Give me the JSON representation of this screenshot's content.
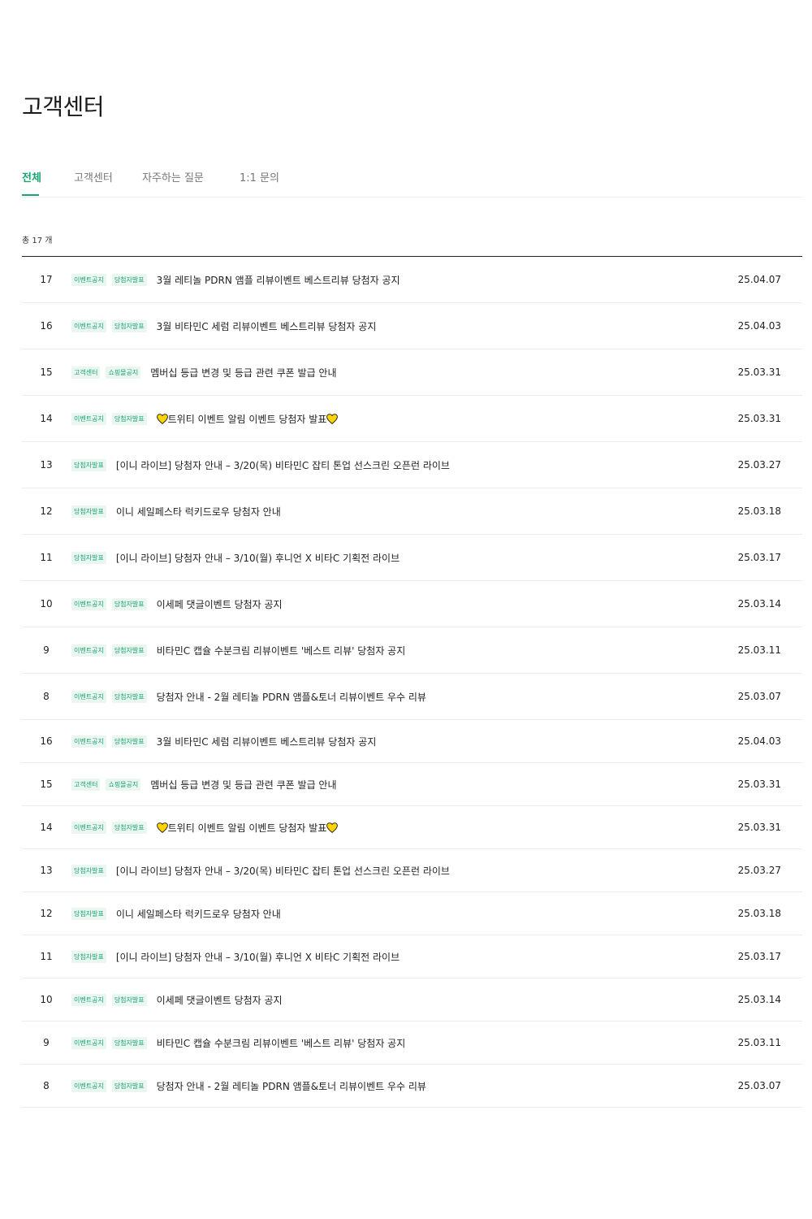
{
  "page_title": "고객센터",
  "tabs": [
    {
      "label": "전체",
      "active": true
    },
    {
      "label": "고객센터",
      "active": false
    },
    {
      "label": "자주하는 질문",
      "active": false
    },
    {
      "label": "1:1 문의",
      "active": false
    }
  ],
  "total_count": "총 17 개",
  "colors": {
    "accent": "#1aa46f",
    "badge_bg": "#eaf7f1",
    "heart": "#ffd400"
  },
  "icons": {
    "heart": "yellow-heart-icon"
  },
  "rows": [
    {
      "num": "17",
      "badges": [
        "이벤트공지",
        "당첨자발표"
      ],
      "pre": "",
      "title": "3월 레티놀 PDRN 앰플 리뷰이벤트 베스트리뷰 당첨자 공지",
      "post": "",
      "date": "25.04.07"
    },
    {
      "num": "16",
      "badges": [
        "이벤트공지",
        "당첨자발표"
      ],
      "pre": "",
      "title": "3월 비타민C 세럼 리뷰이벤트 베스트리뷰 당첨자 공지",
      "post": "",
      "date": "25.04.03"
    },
    {
      "num": "15",
      "badges": [
        "고객센터",
        "쇼핑몰공지"
      ],
      "pre": "",
      "title": "멤버십 등급 변경 및 등급 관련 쿠폰 발급 안내",
      "post": "",
      "date": "25.03.31"
    },
    {
      "num": "14",
      "badges": [
        "이벤트공지",
        "당첨자발표"
      ],
      "pre": "yellow-heart-icon",
      "title": "트위티 이벤트 알림 이벤트 당첨자 발표",
      "post": "yellow-heart-icon",
      "date": "25.03.31"
    },
    {
      "num": "13",
      "badges": [
        "당첨자발표"
      ],
      "pre": "",
      "title": "[이니 라이브] 당첨자 안내 – 3/20(목) 비타민C 잡티 톤업 선스크린 오픈런 라이브",
      "post": "",
      "date": "25.03.27"
    },
    {
      "num": "12",
      "badges": [
        "당첨자발표"
      ],
      "pre": "",
      "title": "이니 세일페스타 럭키드로우 당첨자 안내",
      "post": "",
      "date": "25.03.18"
    },
    {
      "num": "11",
      "badges": [
        "당첨자발표"
      ],
      "pre": "",
      "title": "[이니 라이브] 당첨자 안내 – 3/10(월) 후니언 X 비타C 기획전 라이브",
      "post": "",
      "date": "25.03.17"
    },
    {
      "num": "10",
      "badges": [
        "이벤트공지",
        "당첨자발표"
      ],
      "pre": "",
      "title": "이세페 댓글이벤트 당첨자 공지",
      "post": "",
      "date": "25.03.14"
    },
    {
      "num": "9",
      "badges": [
        "이벤트공지",
        "당첨자발표"
      ],
      "pre": "",
      "title": "비타민C 캡슐 수분크림 리뷰이벤트 '베스트 리뷰' 당첨자 공지",
      "post": "",
      "date": "25.03.11"
    },
    {
      "num": "8",
      "badges": [
        "이벤트공지",
        "당첨자발표"
      ],
      "pre": "",
      "title": "당첨자 안내 - 2월 레티놀 PDRN 앰플&토너 리뷰이벤트 우수 리뷰",
      "post": "",
      "date": "25.03.07"
    },
    {
      "num": "16",
      "badges": [
        "이벤트공지",
        "당첨자발표"
      ],
      "pre": "",
      "title": "3월 비타민C 세럼 리뷰이벤트 베스트리뷰 당첨자 공지",
      "post": "",
      "date": "25.04.03"
    },
    {
      "num": "15",
      "badges": [
        "고객센터",
        "쇼핑몰공지"
      ],
      "pre": "",
      "title": "멤버십 등급 변경 및 등급 관련 쿠폰 발급 안내",
      "post": "",
      "date": "25.03.31"
    },
    {
      "num": "14",
      "badges": [
        "이벤트공지",
        "당첨자발표"
      ],
      "pre": "yellow-heart-icon",
      "title": "트위티 이벤트 알림 이벤트 당첨자 발표",
      "post": "yellow-heart-icon",
      "date": "25.03.31"
    },
    {
      "num": "13",
      "badges": [
        "당첨자발표"
      ],
      "pre": "",
      "title": "[이니 라이브] 당첨자 안내 – 3/20(목) 비타민C 잡티 톤업 선스크린 오픈런 라이브",
      "post": "",
      "date": "25.03.27"
    },
    {
      "num": "12",
      "badges": [
        "당첨자발표"
      ],
      "pre": "",
      "title": "이니 세일페스타 럭키드로우 당첨자 안내",
      "post": "",
      "date": "25.03.18"
    },
    {
      "num": "11",
      "badges": [
        "당첨자발표"
      ],
      "pre": "",
      "title": "[이니 라이브] 당첨자 안내 – 3/10(월) 후니언 X 비타C 기획전 라이브",
      "post": "",
      "date": "25.03.17"
    },
    {
      "num": "10",
      "badges": [
        "이벤트공지",
        "당첨자발표"
      ],
      "pre": "",
      "title": "이세페 댓글이벤트 당첨자 공지",
      "post": "",
      "date": "25.03.14"
    },
    {
      "num": "9",
      "badges": [
        "이벤트공지",
        "당첨자발표"
      ],
      "pre": "",
      "title": "비타민C 캡슐 수분크림 리뷰이벤트 '베스트 리뷰' 당첨자 공지",
      "post": "",
      "date": "25.03.11"
    },
    {
      "num": "8",
      "badges": [
        "이벤트공지",
        "당첨자발표"
      ],
      "pre": "",
      "title": "당첨자 안내 - 2월 레티놀 PDRN 앰플&토너 리뷰이벤트 우수 리뷰",
      "post": "",
      "date": "25.03.07"
    }
  ]
}
